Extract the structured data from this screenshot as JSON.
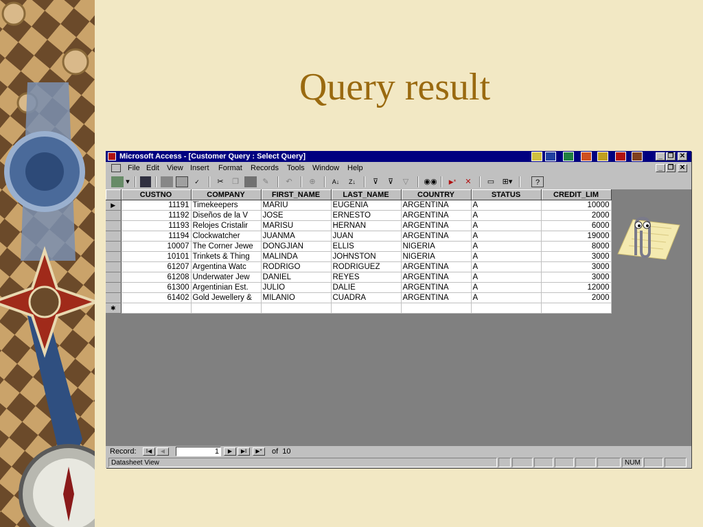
{
  "slide": {
    "title": "Query result"
  },
  "window": {
    "title": "Microsoft Access - [Customer Query : Select Query]",
    "min_label": "_",
    "restore_label": "❐",
    "close_label": "✕"
  },
  "menu": [
    "File",
    "Edit",
    "View",
    "Insert",
    "Format",
    "Records",
    "Tools",
    "Window",
    "Help"
  ],
  "toolbar_icons": [
    "view-icon",
    "save-icon",
    "print-icon",
    "print-preview-icon",
    "spelling-icon",
    "cut-icon",
    "copy-icon",
    "paste-icon",
    "format-painter-icon",
    "undo-icon",
    "hyperlink-icon",
    "sort-ascending-icon",
    "sort-descending-icon",
    "filter-by-selection-icon",
    "filter-by-form-icon",
    "apply-filter-icon",
    "find-icon",
    "new-record-icon",
    "delete-record-icon",
    "database-window-icon",
    "new-object-icon",
    "help-icon"
  ],
  "table": {
    "columns": [
      "CUSTNO",
      "COMPANY",
      "FIRST_NAME",
      "LAST_NAME",
      "COUNTRY",
      "STATUS",
      "CREDIT_LIM"
    ],
    "rows": [
      [
        "11191",
        "Timekeepers",
        "MARIU",
        "EUGENIA",
        "ARGENTINA",
        "A",
        "10000"
      ],
      [
        "11192",
        "Diseños de la V",
        "JOSE",
        "ERNESTO",
        "ARGENTINA",
        "A",
        "2000"
      ],
      [
        "11193",
        "Relojes Cristalir",
        "MARISU",
        "HERNAN",
        "ARGENTINA",
        "A",
        "6000"
      ],
      [
        "11194",
        "Clockwatcher",
        "JUANMA",
        "JUAN",
        "ARGENTINA",
        "A",
        "19000"
      ],
      [
        "10007",
        "The Corner Jewe",
        "DONGJIAN",
        "ELLIS",
        "NIGERIA",
        "A",
        "8000"
      ],
      [
        "10101",
        "Trinkets & Thing",
        "MALINDA",
        "JOHNSTON",
        "NIGERIA",
        "A",
        "3000"
      ],
      [
        "61207",
        "Argentina Watc",
        "RODRIGO",
        "RODRIGUEZ",
        "ARGENTINA",
        "A",
        "3000"
      ],
      [
        "61208",
        "Underwater Jew",
        "DANIEL",
        "REYES",
        "ARGENTINA",
        "A",
        "3000"
      ],
      [
        "61300",
        "Argentinian Est.",
        "JULIO",
        "DALIE",
        "ARGENTINA",
        "A",
        "12000"
      ],
      [
        "61402",
        "Gold Jewellery &",
        "MILANIO",
        "CUADRA",
        "ARGENTINA",
        "A",
        "2000"
      ]
    ],
    "current_marker": "▶",
    "new_marker": "✱"
  },
  "navigation": {
    "label": "Record:",
    "current": "1",
    "of_text": "of  10",
    "first": "I◀",
    "prev": "◀",
    "next": "▶",
    "last": "▶I",
    "new": "▶*"
  },
  "status": {
    "view": "Datasheet View",
    "num": "NUM"
  },
  "colors": {
    "title_bar": "#000080",
    "slide_title": "#9a6a10",
    "slide_bg": "#f2e8c4"
  }
}
